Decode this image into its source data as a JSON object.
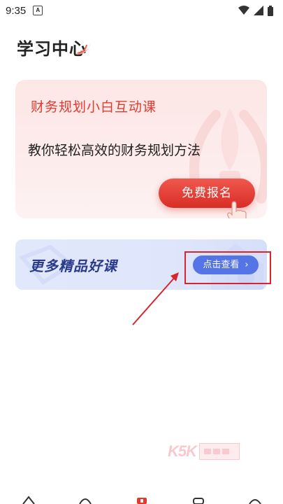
{
  "status_bar": {
    "time": "9:35",
    "app_icon_letter": "A"
  },
  "page": {
    "title": "学习中心"
  },
  "promo_card": {
    "title": "财务规划小白互动课",
    "description": "教你轻松高效的财务规划方法",
    "button_label": "免费报名"
  },
  "more_courses": {
    "title": "更多精品好课",
    "button_label": "点击查看",
    "button_chevron": "›"
  },
  "watermark": {
    "text": "K5K"
  },
  "colors": {
    "accent_red": "#e23b2e",
    "button_blue": "#5575e6",
    "annotation_red": "#d9242b"
  },
  "icons": {
    "status": [
      "app-notification-icon",
      "wifi-icon",
      "signal-icon",
      "battery-icon"
    ],
    "bottom_nav": [
      "home-icon",
      "discover-icon",
      "study-icon",
      "message-icon",
      "profile-icon"
    ]
  }
}
